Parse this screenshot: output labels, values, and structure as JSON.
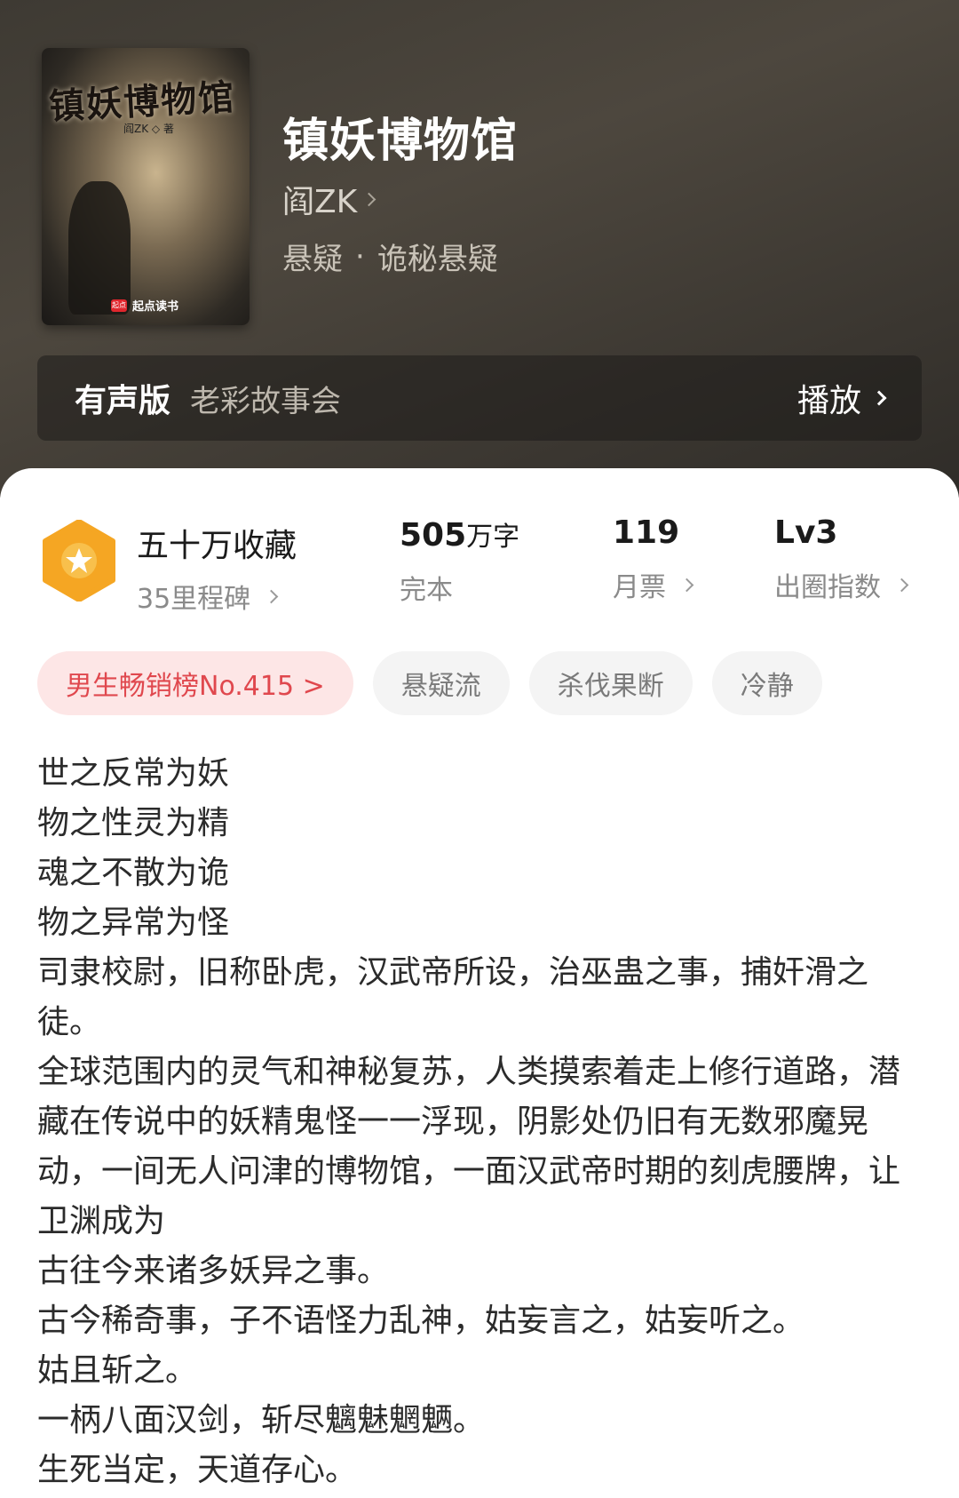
{
  "book": {
    "title": "镇妖博物馆",
    "author": "阎ZK",
    "genre": "悬疑",
    "subgenre": "诡秘悬疑",
    "separator": "·",
    "cover": {
      "title": "镇妖博物馆",
      "author": "阎ZK ◇ 著",
      "publisher_badge": "起点",
      "publisher": "起点读书"
    }
  },
  "audio": {
    "label": "有声版",
    "narrator": "老彩故事会",
    "play_label": "播放"
  },
  "stats": {
    "favorites": "五十万收藏",
    "milestone": "35里程碑",
    "word_count_number": "505",
    "word_count_unit": "万字",
    "status": "完本",
    "monthly_tickets": "119",
    "monthly_tickets_label": "月票",
    "level": "Lv3",
    "level_label": "出圈指数"
  },
  "tags": [
    {
      "label": "男生畅销榜No.415 >"
    },
    {
      "label": "悬疑流"
    },
    {
      "label": "杀伐果断"
    },
    {
      "label": "冷静"
    }
  ],
  "intro": [
    "世之反常为妖",
    "物之性灵为精",
    "魂之不散为诡",
    "物之异常为怪",
    "司隶校尉，旧称卧虎，汉武帝所设，治巫蛊之事，捕奸滑之徒。",
    "全球范围内的灵气和神秘复苏，人类摸索着走上修行道路，潜藏在传说中的妖精鬼怪一一浮现，阴影处仍旧有无数邪魔晃动，一间无人问津的博物馆，一面汉武帝时期的刻虎腰牌，让卫渊成为",
    "古往今来诸多妖异之事。",
    "古今稀奇事，子不语怪力乱神，姑妄言之，姑妄听之。",
    "姑且斩之。",
    "一柄八面汉剑，斩尽魑魅魍魉。",
    "生死当定，天道存心。"
  ],
  "colors": {
    "hero_bg": "#3e3a33",
    "rank_tag_text": "#e0484e",
    "rank_tag_bg": "#fde6e6",
    "badge": "#f5a623"
  },
  "icons": {
    "badge": "star-hexagon-icon",
    "chevron": "chevron-right-icon"
  }
}
